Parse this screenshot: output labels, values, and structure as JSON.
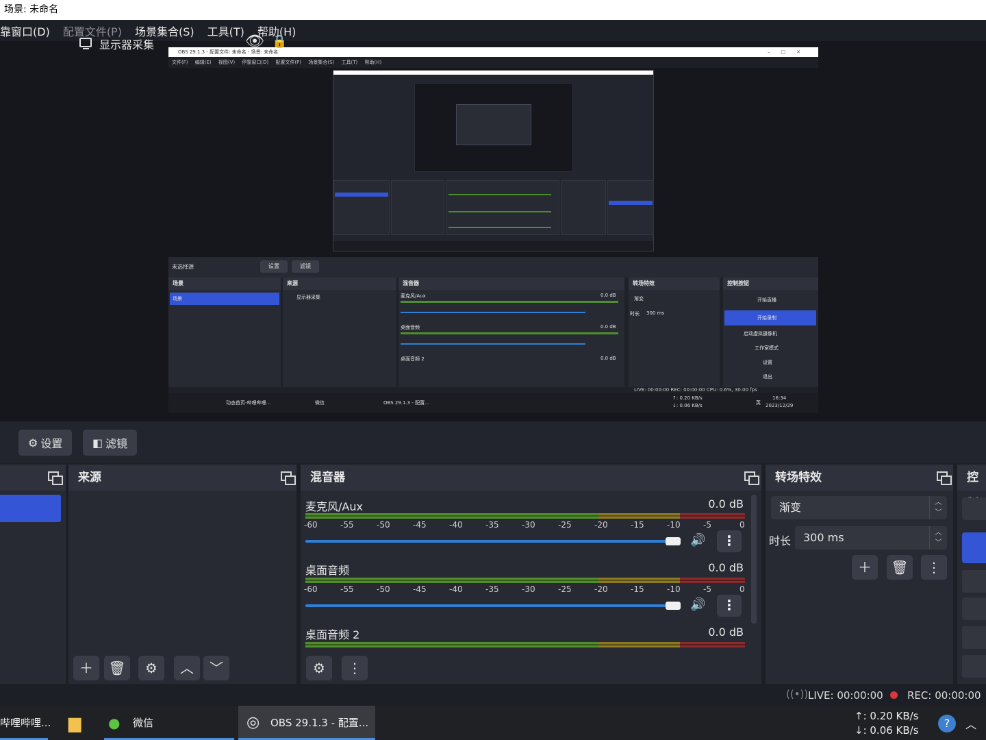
{
  "window": {
    "title": "场景: 未命名"
  },
  "menu": {
    "items": [
      "靠窗口(D)",
      "配置文件(P)",
      "场景集合(S)",
      "工具(T)",
      "帮助(H)"
    ]
  },
  "preview": {
    "title": "OBS 29.1.3 - 配置文件: 未命名 - 场景: 未命名",
    "menu": [
      "文件(F)",
      "编辑(E)",
      "视图(V)",
      "停靠窗口(D)",
      "配置文件(P)",
      "场景集合(S)",
      "工具(T)",
      "帮助(H)"
    ],
    "scene_info": "未选择源",
    "btn_settings": "设置",
    "btn_filters": "滤镜",
    "docks": {
      "scenes": "场景",
      "scene_item": "场景",
      "sources": "来源",
      "source_item": "显示器采集",
      "mixer": "混音器",
      "ch1": "麦克风/Aux",
      "ch2": "桌面音频",
      "ch3": "桌面音频 2",
      "db": "0.0 dB",
      "transitions": "转场特效",
      "fade": "渐变",
      "duration_label": "时长",
      "duration": "300 ms",
      "controls": "控制按钮",
      "c1": "开始直播",
      "c2": "开始录制",
      "c3": "启动虚拟摄像机",
      "c4": "工作室模式",
      "c5": "设置",
      "c6": "退出"
    },
    "status": "LIVE: 00:00:00     REC: 00:00:00     CPU: 0.6%, 30.00 fps",
    "taskbar": {
      "t1": "动态首页-哔哩哔哩...",
      "t2": "微信",
      "t3": "OBS 29.1.3 - 配置...",
      "net_up": "↑: 0.20 KB/s",
      "net_down": "↓: 0.06 KB/s",
      "ime": "英",
      "time": "16:34",
      "date": "2023/12/29"
    }
  },
  "toolbar": {
    "settings": "设置",
    "filters": "滤镜"
  },
  "sources": {
    "title": "来源",
    "items": [
      {
        "name": "显示器采集"
      }
    ]
  },
  "mixer": {
    "title": "混音器",
    "channels": [
      {
        "name": "麦克风/Aux",
        "db": "0.0 dB",
        "level": 0.94
      },
      {
        "name": "桌面音频",
        "db": "0.0 dB",
        "level": 0.94
      },
      {
        "name": "桌面音频 2",
        "db": "0.0 dB",
        "level": 0.94
      }
    ],
    "ticks": [
      "-60",
      "-55",
      "-50",
      "-45",
      "-40",
      "-35",
      "-30",
      "-25",
      "-20",
      "-15",
      "-10",
      "-5",
      "0"
    ]
  },
  "transitions": {
    "title": "转场特效",
    "selected": "渐变",
    "duration_label": "时长",
    "duration_value": "300 ms"
  },
  "controls": {
    "title": "控制"
  },
  "status": {
    "live": "LIVE: 00:00:00",
    "rec": "REC: 00:00:00"
  },
  "taskbar": {
    "bilibili": "哔哩哔哩...",
    "wechat": "微信",
    "obs": "OBS 29.1.3 - 配置...",
    "net_up": "↑: 0.20 KB/s",
    "net_down": "↓: 0.06 KB/s"
  },
  "colors": {
    "accent": "#3355d6",
    "slider": "#2f7fd6",
    "rec": "#d9363e"
  }
}
